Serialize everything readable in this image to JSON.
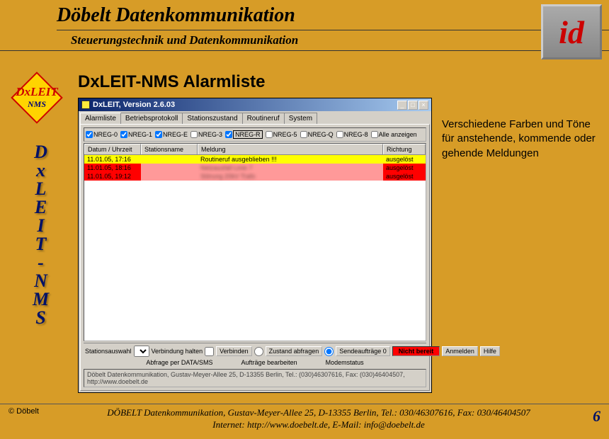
{
  "header": {
    "title": "Döbelt Datenkommunikation",
    "subtitle": "Steuerungstechnik und Datenkommunikation"
  },
  "logo_text": "id",
  "side_logo": {
    "line1": "DxLEIT",
    "line2": "NMS"
  },
  "vertical_title_lines": [
    "D",
    "x",
    "L",
    "E",
    "I",
    "T",
    "-",
    "N",
    "M",
    "S"
  ],
  "page_title": "DxLEIT-NMS Alarmliste",
  "description": "Verschiedene Farben und Töne für anstehende, kommende oder gehende Meldungen",
  "app": {
    "window_title": "DxLEIT, Version 2.6.03",
    "tabs": [
      "Alarmliste",
      "Betriebsprotokoll",
      "Stationszustand",
      "Routineruf",
      "System"
    ],
    "active_tab_index": 0,
    "filters": [
      {
        "label": "NREG-0",
        "checked": true
      },
      {
        "label": "NREG-1",
        "checked": true
      },
      {
        "label": "NREG-E",
        "checked": true
      },
      {
        "label": "NREG-3",
        "checked": false
      },
      {
        "label": "NREG-R",
        "checked": true,
        "boxed": true
      },
      {
        "label": "NREG-5",
        "checked": false
      },
      {
        "label": "NREG-Q",
        "checked": false
      },
      {
        "label": "NREG-8",
        "checked": false
      },
      {
        "label": "Alle anzeigen",
        "checked": false
      }
    ],
    "columns": [
      "Datum / Uhrzeit",
      "Stationsname",
      "Meldung",
      "Richtung"
    ],
    "rows": [
      {
        "date": "11.01.05, 17:16",
        "station": "",
        "msg": "Routineruf ausgeblieben !!!",
        "rich": "ausgelöst",
        "cls": "row-yellow"
      },
      {
        "date": "11.01.05, 18:16",
        "station": "",
        "msg": "Netzausfall Linie 7",
        "rich": "ausgelöst",
        "cls": "row-red",
        "blur": true
      },
      {
        "date": "11.01.05, 19:12",
        "station": "",
        "msg": "Störung 20kV Trafo",
        "rich": "ausgelöst",
        "cls": "row-red",
        "blur": true
      }
    ],
    "bottom": {
      "station_sel_label": "Stationsauswahl",
      "verbindung_halten": "Verbindung halten",
      "verbinden": "Verbinden",
      "abfrage_label": "Abfrage per DATA/SMS",
      "zustand_abfragen": "Zustand abfragen",
      "auftraege_label": "Aufträge bearbeiten",
      "sendeauftraege": "Sendeaufträge 0",
      "modem_label": "Modemstatus",
      "modem_status": "Nicht bereit",
      "anmelden": "Anmelden",
      "hilfe": "Hilfe"
    },
    "status_line": "Döbelt Datenkommunikation, Gustav-Meyer-Allee 25, D-13355 Berlin, Tel.: (030)46307616, Fax: (030)46404507, http://www.doebelt.de"
  },
  "footer": {
    "copyright": "© Döbelt",
    "line1": "DÖBELT Datenkommunikation, Gustav-Meyer-Allee 25, D-13355 Berlin, Tel.: 030/46307616, Fax: 030/46404507",
    "line2": "Internet: http://www.doebelt.de, E-Mail: info@doebelt.de",
    "page_number": "6"
  }
}
